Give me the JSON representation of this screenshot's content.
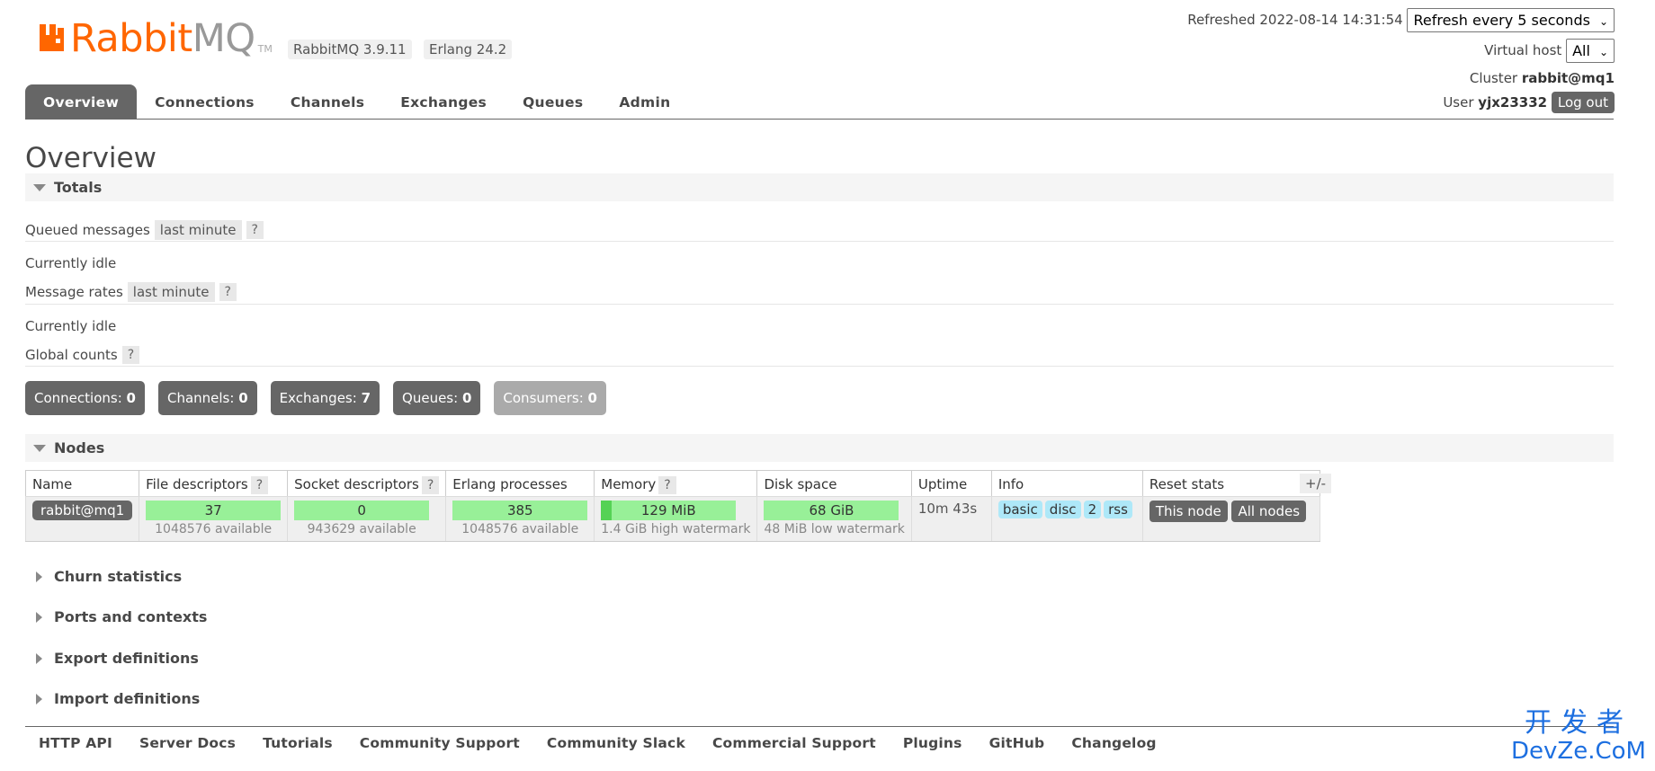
{
  "header": {
    "brand_main": "Rabbit",
    "brand_mq": "MQ",
    "tm": "TM",
    "rabbitmq_version": "RabbitMQ 3.9.11",
    "erlang_version": "Erlang 24.2",
    "refreshed_label": "Refreshed 2022-08-14 14:31:54",
    "refresh_select": "Refresh every 5 seconds",
    "vhost_label": "Virtual host",
    "vhost_select": "All",
    "cluster_label": "Cluster",
    "cluster_name": "rabbit@mq1",
    "user_label": "User",
    "user_name": "yjx23332",
    "logout_label": "Log out"
  },
  "tabs": [
    "Overview",
    "Connections",
    "Channels",
    "Exchanges",
    "Queues",
    "Admin"
  ],
  "page_title": "Overview",
  "totals": {
    "section_label": "Totals",
    "queued_label": "Queued messages",
    "queued_chip": "last minute",
    "help": "?",
    "queued_idle": "Currently idle",
    "rates_label": "Message rates",
    "rates_chip": "last minute",
    "rates_idle": "Currently idle",
    "global_label": "Global counts",
    "counts": [
      {
        "label": "Connections:",
        "value": "0"
      },
      {
        "label": "Channels:",
        "value": "0"
      },
      {
        "label": "Exchanges:",
        "value": "7"
      },
      {
        "label": "Queues:",
        "value": "0"
      },
      {
        "label": "Consumers:",
        "value": "0"
      }
    ]
  },
  "nodes": {
    "section_label": "Nodes",
    "columns": [
      "Name",
      "File descriptors",
      "Socket descriptors",
      "Erlang processes",
      "Memory",
      "Disk space",
      "Uptime",
      "Info",
      "Reset stats"
    ],
    "plus_minus": "+/-",
    "row": {
      "name": "rabbit@mq1",
      "file_descriptors": "37",
      "file_descriptors_available": "1048576 available",
      "socket_descriptors": "0",
      "socket_descriptors_available": "943629 available",
      "erlang_processes": "385",
      "erlang_processes_available": "1048576 available",
      "memory": "129 MiB",
      "memory_fill_fraction": 0.08,
      "memory_watermark": "1.4 GiB high watermark",
      "disk_space": "68 GiB",
      "disk_watermark": "48 MiB low watermark",
      "uptime": "10m 43s",
      "info_tags": [
        "basic",
        "disc",
        "2",
        "rss"
      ],
      "reset_this_node": "This node",
      "reset_all_nodes": "All nodes"
    }
  },
  "collapsed_sections": [
    "Churn statistics",
    "Ports and contexts",
    "Export definitions",
    "Import definitions"
  ],
  "footer_links": [
    "HTTP API",
    "Server Docs",
    "Tutorials",
    "Community Support",
    "Community Slack",
    "Commercial Support",
    "Plugins",
    "GitHub",
    "Changelog"
  ],
  "watermark": {
    "cn": "开发者",
    "en": "DevZe.CoM"
  },
  "colors": {
    "brand_orange": "#ff6600",
    "tab_active": "#666666",
    "bar_green": "#98f098",
    "info_tag": "#aee8f8"
  }
}
